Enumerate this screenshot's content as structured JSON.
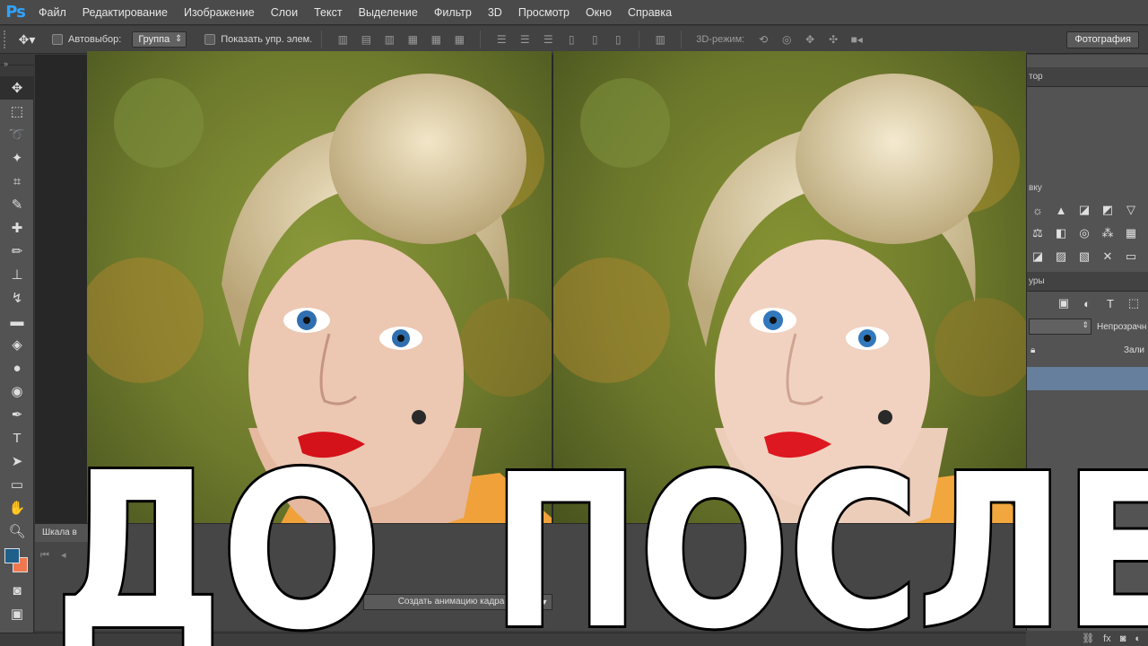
{
  "app": {
    "logo": "Ps"
  },
  "menu": [
    "Файл",
    "Редактирование",
    "Изображение",
    "Слои",
    "Текст",
    "Выделение",
    "Фильтр",
    "3D",
    "Просмотр",
    "Окно",
    "Справка"
  ],
  "options": {
    "autoselect_label": "Автовыбор:",
    "autoselect_value": "Группа",
    "show_transform_label": "Показать упр. элем.",
    "mode_3d_label": "3D-режим:",
    "workspace": "Фотография"
  },
  "right_panel": {
    "tab_top": "тор",
    "tab_adjust": "вку",
    "tab_layers": "уры",
    "opacity_label": "Непрозрачн",
    "fill_label": "Зали"
  },
  "timeline": {
    "tab_label": "Шкала в",
    "create_animation": "Создать анимацию кадра"
  },
  "overlay": {
    "before": "ДО",
    "after": "ПОСЛЕ"
  },
  "colors": {
    "foreground": "#1f5f8a",
    "background": "#f07850",
    "selected_layer": "#667f9c"
  }
}
